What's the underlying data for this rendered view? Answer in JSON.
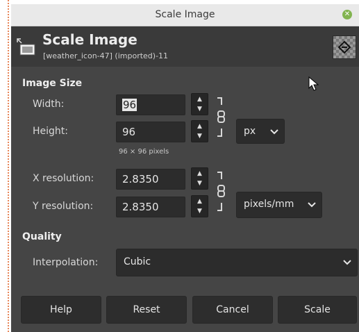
{
  "window": {
    "title": "Scale Image"
  },
  "header": {
    "title": "Scale Image",
    "subtitle": "[weather_icon-47] (imported)-11"
  },
  "image_size": {
    "section_label": "Image Size",
    "width_label": "Width:",
    "width_value": "96",
    "height_label": "Height:",
    "height_value": "96",
    "unit": "px",
    "pixels_hint": "96 × 96 pixels",
    "xres_label": "X resolution:",
    "xres_value": "2.8350",
    "yres_label": "Y resolution:",
    "yres_value": "2.8350",
    "res_unit": "pixels/mm"
  },
  "quality": {
    "section_label": "Quality",
    "interp_label": "Interpolation:",
    "interp_value": "Cubic"
  },
  "buttons": {
    "help": "Help",
    "reset": "Reset",
    "cancel": "Cancel",
    "scale": "Scale"
  },
  "colors": {
    "dialog_bg": "#454545",
    "field_bg": "#2c2c2c",
    "titlebar_bg": "#e9e9e9",
    "close_button": "#82b450",
    "edge_marker": "#e8875a"
  },
  "icons": {
    "header": "scale-image-icon",
    "close": "close-icon",
    "chain": "chain-link-icon",
    "chevron": "chevron-down-icon",
    "cursor": "mouse-pointer-icon"
  }
}
